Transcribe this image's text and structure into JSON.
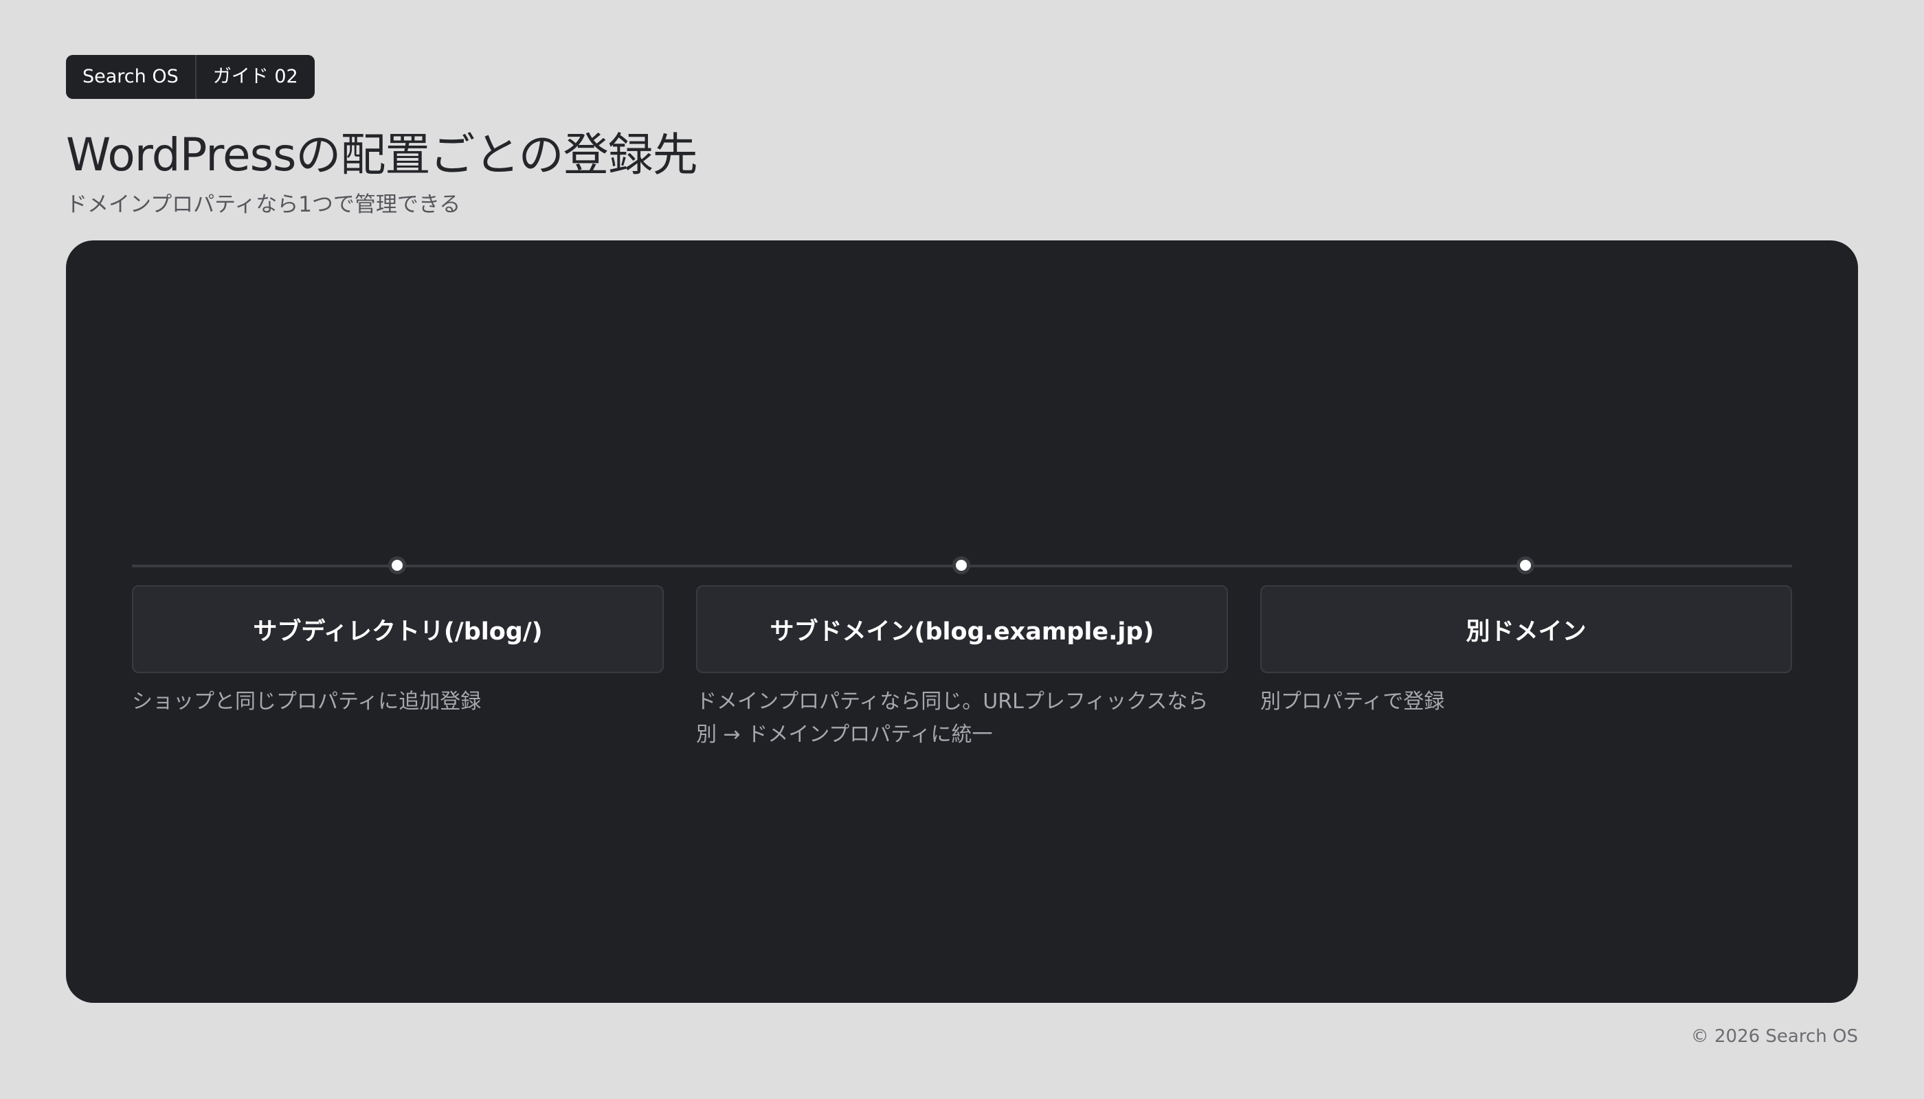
{
  "header": {
    "badges": [
      "Search OS",
      "ガイド 02"
    ],
    "title": "WordPressの配置ごとの登録先",
    "subtitle": "ドメインプロパティなら1つで管理できる"
  },
  "stages": [
    {
      "title": "サブディレクトリ(/blog/)",
      "description": "ショップと同じプロパティに追加登録"
    },
    {
      "title": "サブドメイン(blog.example.jp)",
      "description": "ドメインプロパティなら同じ。URLプレフィックスなら別 → ドメインプロパティに統一"
    },
    {
      "title": "別ドメイン",
      "description": "別プロパティで登録"
    }
  ],
  "footer": {
    "copyright": "© 2026 Search OS"
  },
  "colors": {
    "background": "#dedede",
    "panel": "#202125",
    "card": "#292a2f",
    "card_border": "#3a3b40",
    "line": "#3b3c41",
    "title_text": "#25262a",
    "card_text": "#ffffff",
    "description_text": "#a7a8ad"
  }
}
